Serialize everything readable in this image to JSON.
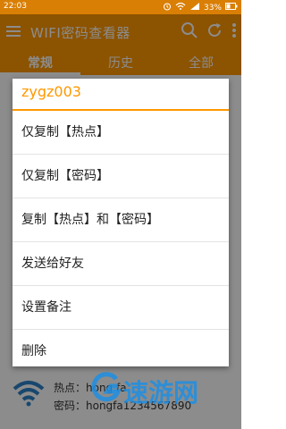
{
  "status_bar": {
    "time": "22:03",
    "battery": "33%"
  },
  "app_bar": {
    "title": "WIFI密码查看器"
  },
  "tabs": [
    {
      "label": "常规"
    },
    {
      "label": "历史"
    },
    {
      "label": "全部"
    }
  ],
  "dialog": {
    "title": "zygz003",
    "items": [
      {
        "label": "仅复制【热点】"
      },
      {
        "label": "仅复制【密码】"
      },
      {
        "label": "复制【热点】和【密码】"
      },
      {
        "label": "发送给好友"
      },
      {
        "label": "设置备注"
      },
      {
        "label": "删除"
      }
    ]
  },
  "list_item_bottom": {
    "hotspot_line": "热点：hong fa",
    "password_line": "密码：hongfa1234567890"
  },
  "watermark": {
    "text": "速游网"
  },
  "colors": {
    "accent": "#ff9800",
    "statusbar": "#d97f06",
    "watermark": "#1e8fe3"
  }
}
